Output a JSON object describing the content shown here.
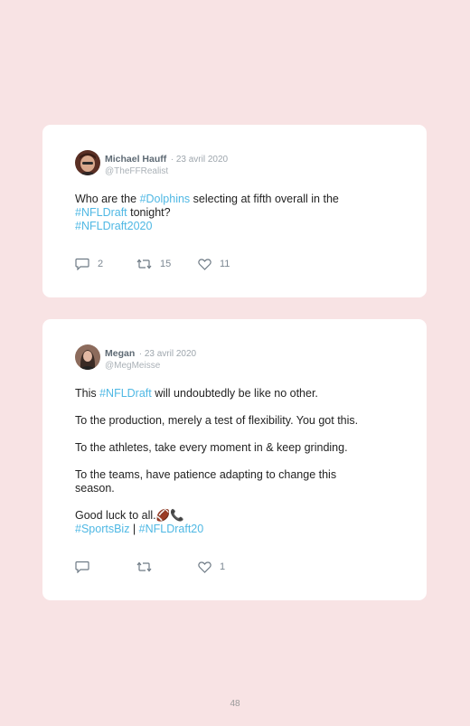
{
  "tweets": [
    {
      "name": "Michael Hauff",
      "date": "· 23 avril 2020",
      "handle": "@TheFFRealist",
      "line1_pre": "Who are the ",
      "line1_tag": "#Dolphins",
      "line1_post": " selecting at fifth overall in the",
      "line2_tag": "#NFLDraft",
      "line2_post": " tonight?",
      "line3_tag": "#NFLDraft2020",
      "replies": "2",
      "retweets": "15",
      "likes": "11"
    },
    {
      "name": "Megan",
      "date": "· 23 avril 2020",
      "handle": "@MegMeisse",
      "p1_pre": "This ",
      "p1_tag": "#NFLDraft",
      "p1_post": " will undoubtedly be like no other.",
      "p2": "To the production, merely a test of flexibility. You got this.",
      "p3": "To the athletes, take every moment in & keep grinding.",
      "p4": "To the teams, have patience adapting to change this season.",
      "p5": "Good luck to all.",
      "p5_emoji": "🏈📞",
      "tag1": "#SportsBiz",
      "sep": " | ",
      "tag2": "#NFLDraft20",
      "replies": "",
      "retweets": "",
      "likes": "1"
    }
  ],
  "icons": {
    "reply": "speech-bubble-icon",
    "retweet": "retweet-arrows-icon",
    "like": "heart-icon"
  },
  "colors": {
    "background": "#f8e3e4",
    "card": "#ffffff",
    "hashtag": "#4fb8e4"
  },
  "page_number": "48"
}
